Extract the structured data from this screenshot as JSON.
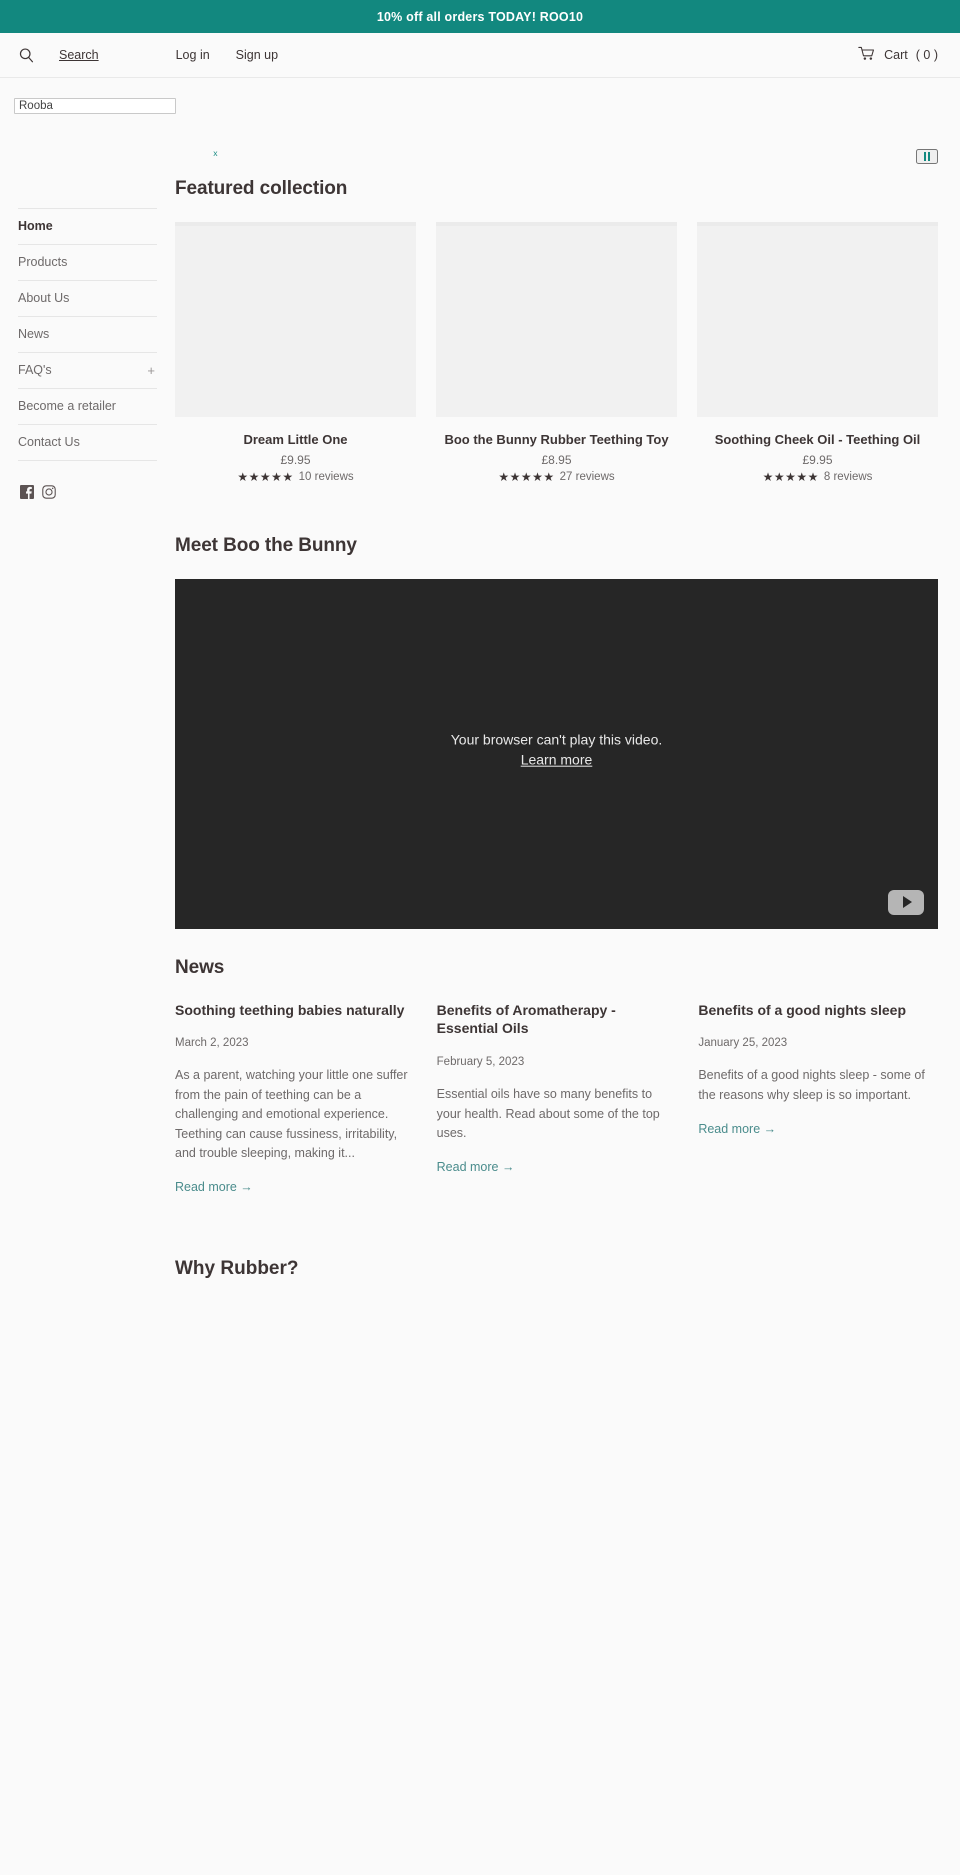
{
  "announcement": {
    "text": "10% off all orders TODAY! ROO10",
    "bg_color": "#12887f",
    "text_color": "#ffffff"
  },
  "header": {
    "search_icon": "search-icon",
    "search_label": "Search",
    "login_label": "Log in",
    "signup_label": "Sign up",
    "cart_icon": "cart-icon",
    "cart_label": "Cart",
    "cart_count": "( 0 )"
  },
  "search_field": {
    "value": "Rooba",
    "placeholder": "Search"
  },
  "sidebar": {
    "items": [
      {
        "label": "Home",
        "active": true,
        "expandable": false
      },
      {
        "label": "Products",
        "active": false,
        "expandable": false
      },
      {
        "label": "About Us",
        "active": false,
        "expandable": false
      },
      {
        "label": "News",
        "active": false,
        "expandable": false
      },
      {
        "label": "FAQ's",
        "active": false,
        "expandable": true,
        "expand_symbol": "+"
      },
      {
        "label": "Become a retailer",
        "active": false,
        "expandable": false
      },
      {
        "label": "Contact Us",
        "active": false,
        "expandable": false
      }
    ],
    "social": [
      {
        "name": "facebook-icon"
      },
      {
        "name": "instagram-icon"
      }
    ]
  },
  "slider": {
    "dot_marker": "x",
    "pause_icon": "pause-icon",
    "accent_color": "#12887f"
  },
  "featured": {
    "title": "Featured collection",
    "products": [
      {
        "title": "Dream Little One",
        "price": "£9.95",
        "stars": "★★★★★",
        "rating_value": 5,
        "reviews": "10 reviews"
      },
      {
        "title": "Boo the Bunny Rubber Teething Toy",
        "price": "£8.95",
        "stars": "★★★★★",
        "rating_value": 5,
        "reviews": "27 reviews"
      },
      {
        "title": "Soothing Cheek Oil - Teething Oil",
        "price": "£9.95",
        "stars": "★★★★★",
        "rating_value": 5,
        "reviews": "8 reviews"
      }
    ]
  },
  "video": {
    "title": "Meet Boo the Bunny",
    "error_text": "Your browser can't play this video.",
    "learn_more": "Learn more",
    "play_icon": "play-icon"
  },
  "news": {
    "title": "News",
    "articles": [
      {
        "title": "Soothing teething babies naturally",
        "date": "March 2, 2023",
        "excerpt": "As a parent, watching your little one suffer from the pain of teething can be a challenging and emotional experience. Teething can cause fussiness, irritability, and trouble sleeping, making it...",
        "read_more": "Read more →"
      },
      {
        "title": "Benefits of Aromatherapy - Essential Oils",
        "date": "February 5, 2023",
        "excerpt": "Essential oils have so many benefits to your health. Read about some of the top uses.",
        "read_more": "Read more →"
      },
      {
        "title": "Benefits of a good nights sleep",
        "date": "January 25, 2023",
        "excerpt": "Benefits of a good nights sleep - some of the reasons why sleep is so important.",
        "read_more": "Read more →"
      }
    ]
  },
  "why": {
    "title": "Why Rubber?"
  }
}
